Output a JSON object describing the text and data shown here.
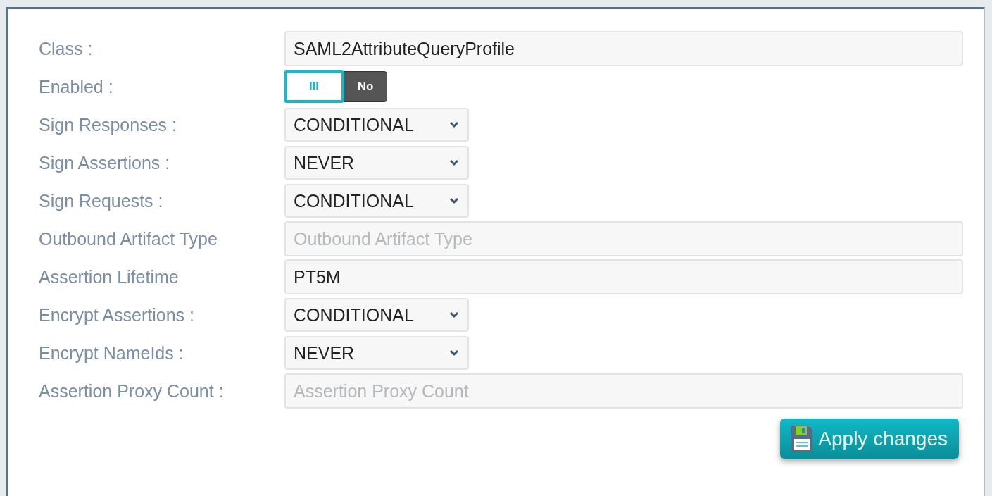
{
  "fields": [
    {
      "kind": "text",
      "label": "Class :",
      "value": "SAML2AttributeQueryProfile"
    },
    {
      "kind": "toggle",
      "label": "Enabled :",
      "on": false,
      "focused": true,
      "grip": "III",
      "off_text": "No"
    },
    {
      "kind": "select",
      "label": "Sign Responses :",
      "value": "CONDITIONAL"
    },
    {
      "kind": "select",
      "label": "Sign Assertions :",
      "value": "NEVER"
    },
    {
      "kind": "select",
      "label": "Sign Requests :",
      "value": "CONDITIONAL"
    },
    {
      "kind": "text",
      "label": "Outbound Artifact Type",
      "placeholder": "Outbound Artifact Type"
    },
    {
      "kind": "text",
      "label": "Assertion Lifetime",
      "value": "PT5M"
    },
    {
      "kind": "select",
      "label": "Encrypt Assertions :",
      "value": "CONDITIONAL"
    },
    {
      "kind": "select",
      "label": "Encrypt NameIds :",
      "value": "NEVER"
    },
    {
      "kind": "text",
      "label": "Assertion Proxy Count :",
      "placeholder": "Assertion Proxy Count"
    }
  ],
  "apply_button": {
    "label": "Apply changes"
  }
}
